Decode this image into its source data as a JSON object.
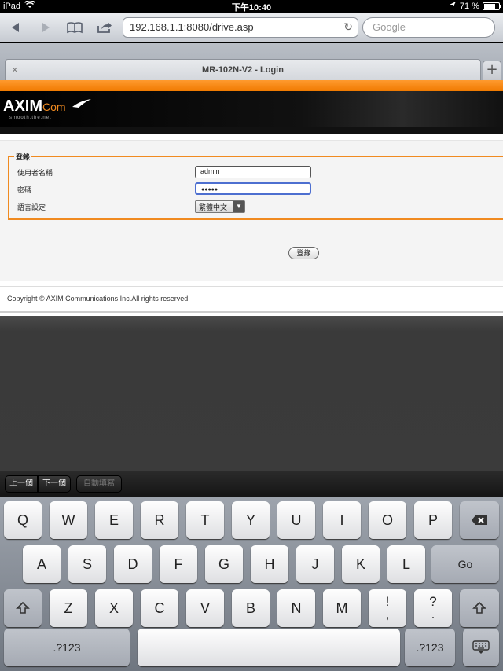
{
  "status_bar": {
    "device": "iPad",
    "time": "下午10:40",
    "battery": "71 %"
  },
  "toolbar": {
    "url": "192.168.1.1:8080/drive.asp",
    "search_placeholder": "Google"
  },
  "tabs": {
    "active_title": "MR-102N-V2 - Login",
    "close_label": "×",
    "new_tab_label": "+"
  },
  "header": {
    "logo_text": "AXIM",
    "logo_suffix": "Com",
    "tagline": "smooth.the.net"
  },
  "login_form": {
    "legend": "登錄",
    "username_label": "使用者名稱",
    "username_value": "admin",
    "password_label": "密碼",
    "password_value": "●●●●●",
    "language_label": "語言設定",
    "language_value": "繁體中文",
    "submit_label": "登錄"
  },
  "footer": {
    "copyright": "Copyright © AXIM Communications Inc.All rights reserved."
  },
  "form_assistant": {
    "prev_label": "上一個",
    "next_label": "下一個",
    "autofill_label": "自動填寫"
  },
  "keyboard": {
    "row1": [
      "Q",
      "W",
      "E",
      "R",
      "T",
      "Y",
      "U",
      "I",
      "O",
      "P"
    ],
    "row2": [
      "A",
      "S",
      "D",
      "F",
      "G",
      "H",
      "J",
      "K",
      "L"
    ],
    "row3": [
      "Z",
      "X",
      "C",
      "V",
      "B",
      "N",
      "M"
    ],
    "go_label": "Go",
    "numbers_label": ".?123",
    "punct1_top": "!",
    "punct1_bottom": ",",
    "punct2_top": "?",
    "punct2_bottom": "."
  },
  "colors": {
    "accent_orange": "#f08a20",
    "banner_black": "#000000"
  }
}
